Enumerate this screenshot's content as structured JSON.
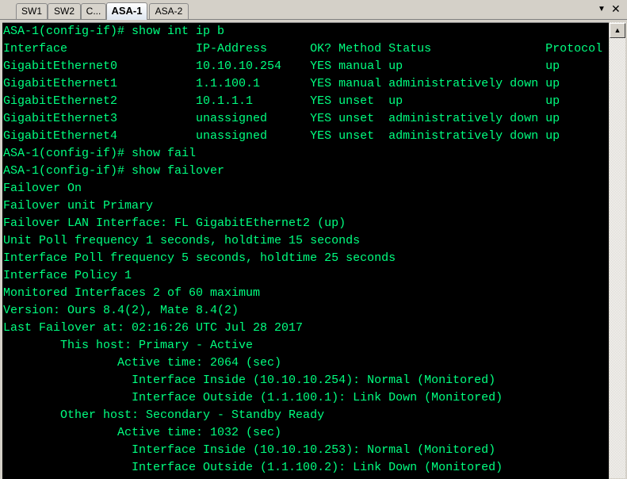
{
  "tabs": [
    "SW1",
    "SW2",
    "C...",
    "ASA-1",
    "ASA-2"
  ],
  "active_tab": "ASA-1",
  "controls": {
    "menu": "▼",
    "close": "✕",
    "scroll_up": "▲"
  },
  "terminal": {
    "lines": [
      "ASA-1(config-if)# show int ip b",
      "Interface                  IP-Address      OK? Method Status                Protocol",
      "GigabitEthernet0           10.10.10.254    YES manual up                    up",
      "GigabitEthernet1           1.1.100.1       YES manual administratively down up",
      "GigabitEthernet2           10.1.1.1        YES unset  up                    up",
      "GigabitEthernet3           unassigned      YES unset  administratively down up",
      "GigabitEthernet4           unassigned      YES unset  administratively down up",
      "ASA-1(config-if)# show fail",
      "ASA-1(config-if)# show failover",
      "Failover On",
      "Failover unit Primary",
      "Failover LAN Interface: FL GigabitEthernet2 (up)",
      "Unit Poll frequency 1 seconds, holdtime 15 seconds",
      "Interface Poll frequency 5 seconds, holdtime 25 seconds",
      "Interface Policy 1",
      "Monitored Interfaces 2 of 60 maximum",
      "Version: Ours 8.4(2), Mate 8.4(2)",
      "Last Failover at: 02:16:26 UTC Jul 28 2017",
      "        This host: Primary - Active",
      "                Active time: 2064 (sec)",
      "                  Interface Inside (10.10.10.254): Normal (Monitored)",
      "                  Interface Outside (1.1.100.1): Link Down (Monitored)",
      "        Other host: Secondary - Standby Ready",
      "                Active time: 1032 (sec)",
      "                  Interface Inside (10.10.10.253): Normal (Monitored)",
      "                  Interface Outside (1.1.100.2): Link Down (Monitored)"
    ]
  }
}
